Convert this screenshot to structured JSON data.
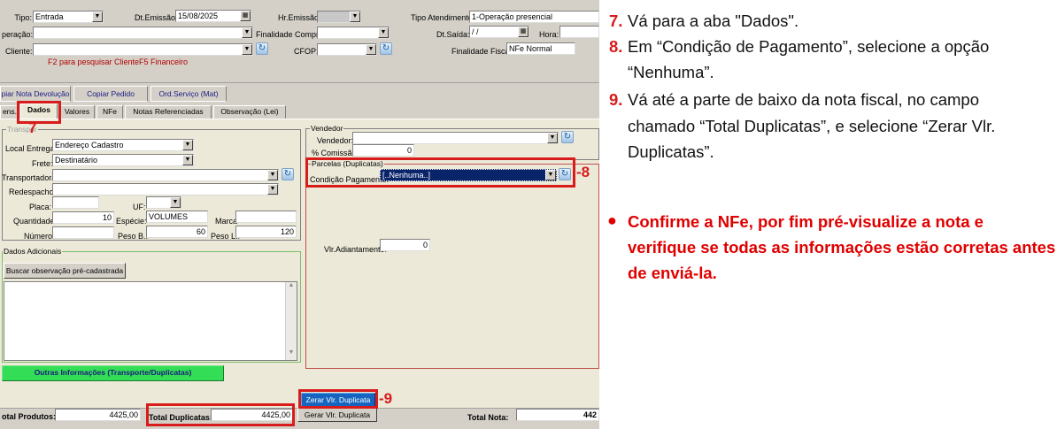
{
  "header": {
    "tipo_label": "Tipo:",
    "tipo_value": "Entrada",
    "dtemissao_label": "Dt.Emissão:",
    "dtemissao_value": "15/08/2025",
    "hremissao_label": "Hr.Emissão:",
    "tipo_atendimento_label": "Tipo Atendimento:",
    "tipo_atendimento_value": "1-Operação presencial",
    "operacao_label": "peração:",
    "finalidade_compra_label": "Finalidade Compra:",
    "dtsaida_label": "Dt.Saída:",
    "dtsaida_value": " / /",
    "hora_label": "Hora:",
    "cliente_label": "Cliente:",
    "cfop_label": "CFOP:",
    "finalidade_fiscal_label": "Finalidade Fiscal:",
    "finalidade_fiscal_value": "NFe Normal",
    "hint_f2": "F2 para pesquisar Cliente",
    "hint_f5": "F5 Financeiro"
  },
  "action_tabs": [
    "piar Nota Devolução",
    "Copiar Pedido",
    "Ord.Serviço (Mat)"
  ],
  "tabs": [
    "ens.",
    "Dados",
    "Valores",
    "NFe",
    "Notas Referenciadas",
    "Observação (Lei)"
  ],
  "markers": {
    "seven": "7",
    "eight": "-8",
    "nine": "-9"
  },
  "transporte": {
    "title": "Transpor",
    "local_entrega_label": "Local Entrega:",
    "local_entrega_value": "Endereço Cadastro",
    "frete_label": "Frete:",
    "frete_value": "Destinatário",
    "transportadora_label": "Transportadora:",
    "redespacho_label": "Redespacho:",
    "placa_label": "Placa:",
    "uf_label": "UF:",
    "quantidade_label": "Quantidade:",
    "quantidade_value": "10",
    "especie_label": "Espécie:",
    "especie_value": "VOLUMES",
    "marca_label": "Marca",
    "numero_label": "Número:",
    "pesob_label": "Peso B.:",
    "pesob_value": "60",
    "pesol_label": "Peso L.:",
    "pesol_value": "120"
  },
  "dados_adicionais": {
    "title": "Dados Adicionais",
    "buscar_label": "Buscar observação pré-cadastrada",
    "outras_label": "Outras Informações (Transporte/Duplicatas)"
  },
  "vendedor": {
    "title": "Vendedor",
    "vendedor_label": "Vendedor:",
    "comissao_label": "% Comissão:",
    "comissao_value": "0"
  },
  "parcelas": {
    "title": "Parcelas (Duplicatas)",
    "condicao_label": "Condição Pagamento:",
    "condicao_value": "[..Nenhuma..]",
    "adiantamento_label": "Vlr.Adiantamento:",
    "adiantamento_value": "0"
  },
  "footer": {
    "zerar_label": "Zerar Vlr. Duplicata",
    "gerar_label": "Gerar Vlr. Duplicata",
    "total_produtos_label": "otal Produtos:",
    "total_produtos_value": "4425,00",
    "total_duplicatas_label": "Total Duplicatas:",
    "total_duplicatas_value": "4425,00",
    "total_nota_label": "Total Nota:",
    "total_nota_value": "442"
  },
  "instructions": [
    {
      "num": "7.",
      "text": "Vá para a aba \"Dados\"."
    },
    {
      "num": "8.",
      "text": "Em “Condição de Pagamento”, selecione a opção"
    },
    {
      "num": "",
      "text": "“Nenhuma”."
    },
    {
      "num": "9.",
      "text": "Vá até a parte de baixo da nota fiscal, no campo"
    },
    {
      "num": "",
      "text": "chamado “Total Duplicatas”, e selecione “Zerar Vlr."
    },
    {
      "num": "",
      "text": "Duplicatas”."
    }
  ],
  "bullet": {
    "line1": "Confirme a NFe, por fim pré-visualize a nota e",
    "line2": "verifique se todas as informações estão corretas antes",
    "line3": "de enviá-la."
  },
  "colors": {
    "accent_red": "#d81b1b",
    "selection_blue": "#0a246a",
    "panel": "#d4d0c8",
    "green_button": "#33dd55"
  }
}
